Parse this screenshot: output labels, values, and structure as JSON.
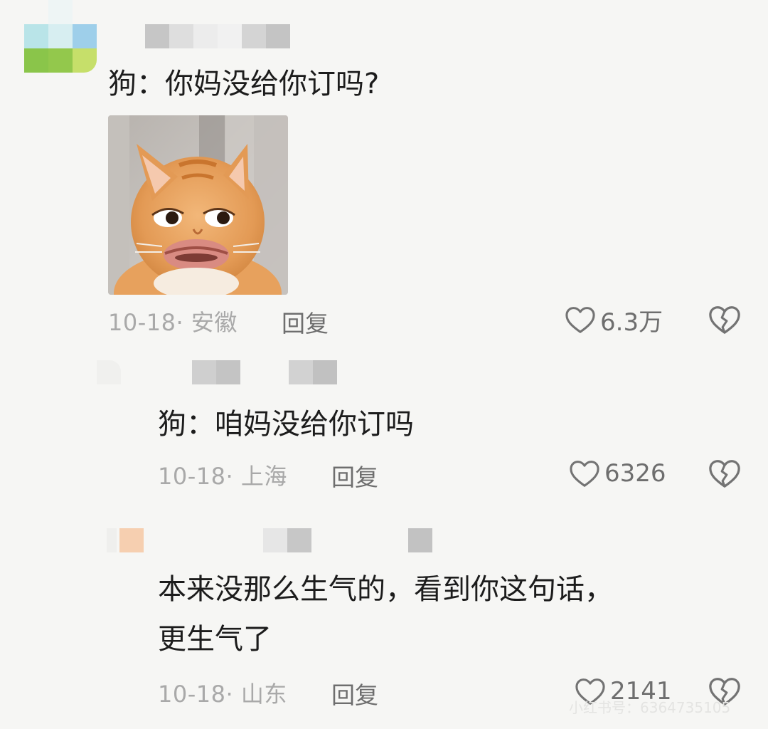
{
  "comments": [
    {
      "text": "狗：你妈没给你订吗?",
      "date_location": "10-18· 安徽",
      "reply_label": "回复",
      "likes": "6.3万",
      "has_image": true,
      "image_icon": "cat-sticker"
    },
    {
      "text": "狗：咱妈没给你订吗",
      "date_location": "10-18· 上海",
      "reply_label": "回复",
      "likes": "6326"
    },
    {
      "text_line1": "本来没那么生气的，看到你这句话，",
      "text_line2": "更生气了",
      "date_location": "10-18· 山东",
      "reply_label": "回复",
      "likes": "2141"
    }
  ],
  "icons": {
    "like": "heart-outline-icon",
    "dislike": "broken-heart-icon"
  },
  "watermark": "小红书号：6364735105"
}
